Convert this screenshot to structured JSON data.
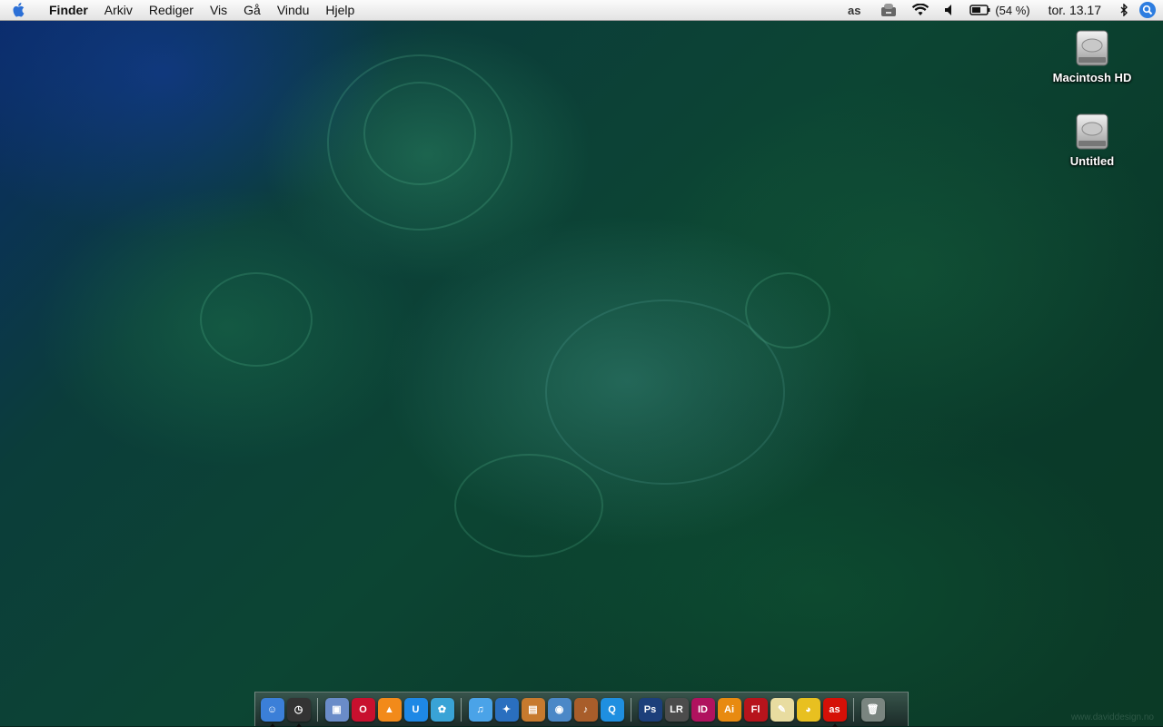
{
  "menubar": {
    "app_name": "Finder",
    "items": [
      "Arkiv",
      "Rediger",
      "Vis",
      "Gå",
      "Vindu",
      "Hjelp"
    ],
    "battery_text": "(54 %)",
    "clock": "tor. 13.17",
    "status_icons": [
      "lastfm-icon",
      "tray-icon",
      "wifi-icon",
      "volume-icon",
      "battery-icon",
      "bluetooth-icon",
      "spotlight-icon"
    ]
  },
  "desktop_icons": [
    {
      "label": "Macintosh HD",
      "icon": "hard-drive-icon"
    },
    {
      "label": "Untitled",
      "icon": "hard-drive-icon"
    }
  ],
  "dock": {
    "group1": [
      {
        "name": "finder",
        "glyph": "☺",
        "bg": "#3b7fd8",
        "running": true
      },
      {
        "name": "dashboard",
        "glyph": "◷",
        "bg": "#333333",
        "running": true
      }
    ],
    "group2": [
      {
        "name": "preview",
        "glyph": "▣",
        "bg": "#6a8cc8",
        "running": false
      },
      {
        "name": "opera",
        "glyph": "O",
        "bg": "#c8102e",
        "running": false
      },
      {
        "name": "vlc",
        "glyph": "▲",
        "bg": "#f28a1a",
        "running": false
      },
      {
        "name": "wunderlist",
        "glyph": "U",
        "bg": "#1e88e5",
        "running": false
      },
      {
        "name": "messenger",
        "glyph": "✿",
        "bg": "#39a3d6",
        "running": false
      }
    ],
    "group3": [
      {
        "name": "itunes",
        "glyph": "♫",
        "bg": "#4aa3e8",
        "running": false
      },
      {
        "name": "imovie",
        "glyph": "✦",
        "bg": "#2a6fbf",
        "running": false
      },
      {
        "name": "iphoto",
        "glyph": "▤",
        "bg": "#c77a2e",
        "running": false
      },
      {
        "name": "idvd",
        "glyph": "◉",
        "bg": "#4b88c7",
        "running": false
      },
      {
        "name": "garageband",
        "glyph": "♪",
        "bg": "#a85d2a",
        "running": false
      },
      {
        "name": "quicktime",
        "glyph": "Q",
        "bg": "#1f8fe0",
        "running": false
      }
    ],
    "group4": [
      {
        "name": "photoshop",
        "glyph": "Ps",
        "bg": "#1c3f7a",
        "running": false
      },
      {
        "name": "lightroom",
        "glyph": "LR",
        "bg": "#4c4c4c",
        "running": false
      },
      {
        "name": "indesign",
        "glyph": "ID",
        "bg": "#b0125e",
        "running": false
      },
      {
        "name": "illustrator",
        "glyph": "Ai",
        "bg": "#e88a10",
        "running": false
      },
      {
        "name": "flash",
        "glyph": "Fl",
        "bg": "#b7141c",
        "running": false
      },
      {
        "name": "feather",
        "glyph": "✎",
        "bg": "#e8dca0",
        "running": false
      },
      {
        "name": "adium",
        "glyph": "◕",
        "bg": "#e8c020",
        "running": false
      },
      {
        "name": "lastfm",
        "glyph": "as",
        "bg": "#d51007",
        "running": true
      }
    ],
    "trash": {
      "name": "trash",
      "glyph": "🗑",
      "bg": "#7a8580"
    }
  },
  "watermark": "www.daviddesign.no"
}
